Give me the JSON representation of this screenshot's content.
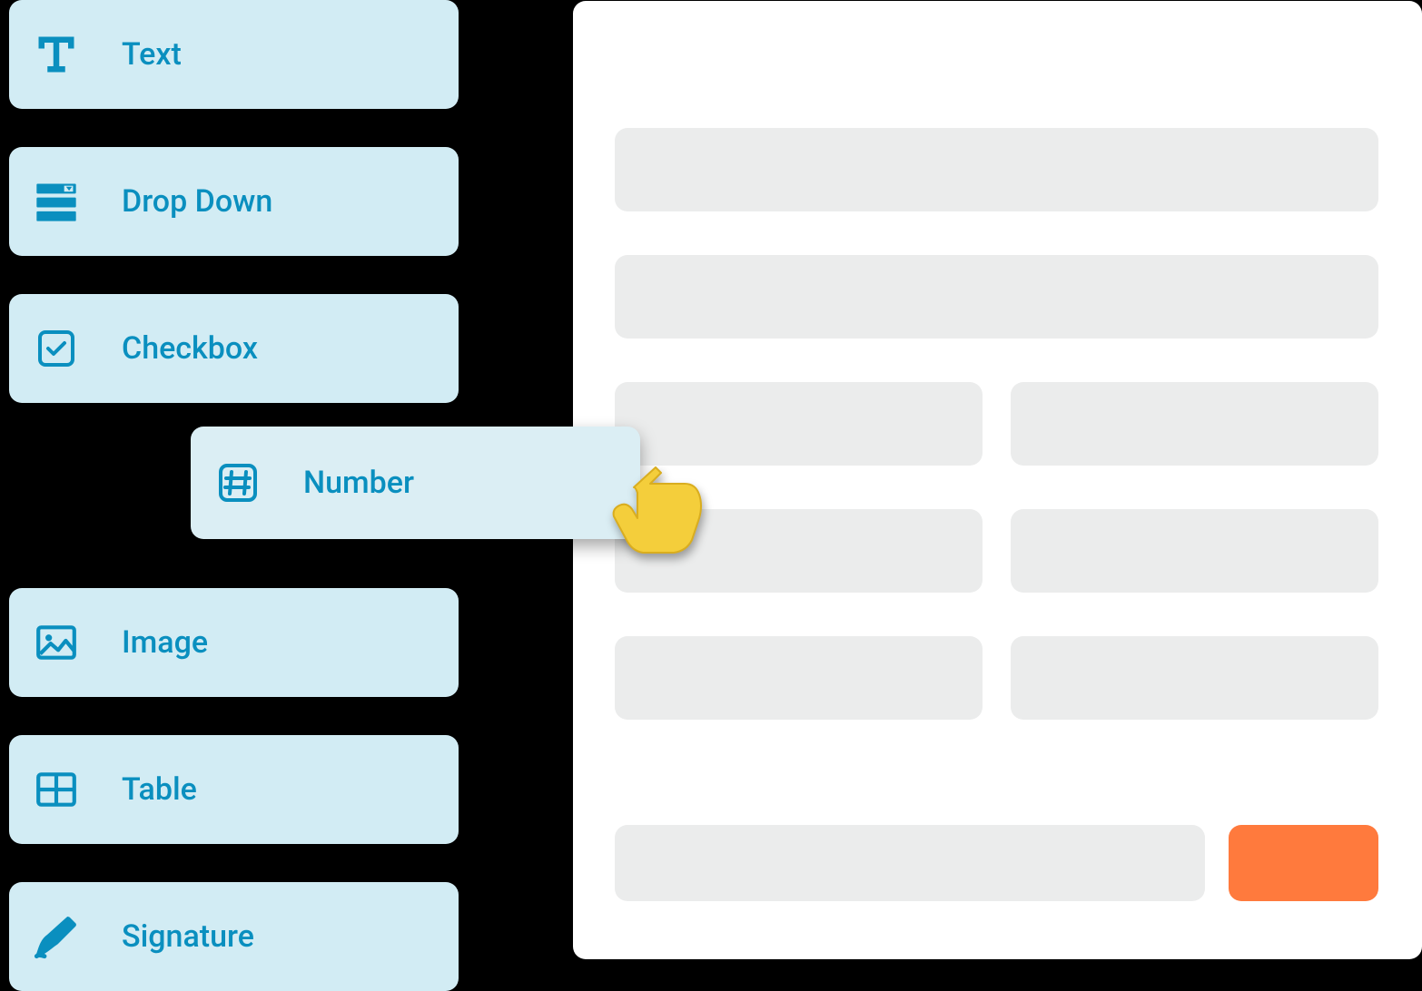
{
  "palette": {
    "items": [
      {
        "label": "Text",
        "icon": "text-icon"
      },
      {
        "label": "Drop Down",
        "icon": "dropdown-icon"
      },
      {
        "label": "Checkbox",
        "icon": "checkbox-icon"
      },
      {
        "label": "Image",
        "icon": "image-icon"
      },
      {
        "label": "Table",
        "icon": "table-icon"
      },
      {
        "label": "Signature",
        "icon": "signature-icon"
      }
    ]
  },
  "dragging": {
    "label": "Number",
    "icon": "hash-icon"
  },
  "colors": {
    "palette_bg": "#d2ecf4",
    "accent": "#0a8fbf",
    "button": "#ff7a3d",
    "placeholder": "#ebecec",
    "canvas": "#ffffff",
    "backdrop": "#000000"
  }
}
